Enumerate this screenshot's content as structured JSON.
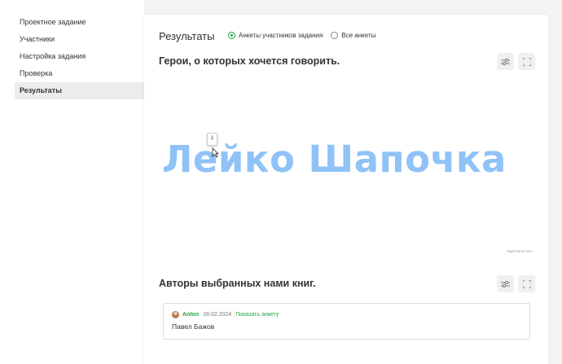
{
  "sidebar": {
    "items": [
      {
        "label": "Проектное задание"
      },
      {
        "label": "Участники"
      },
      {
        "label": "Настройка задания"
      },
      {
        "label": "Проверка"
      },
      {
        "label": "Результаты"
      }
    ]
  },
  "results": {
    "title": "Результаты",
    "filter_options": [
      {
        "label": "Анкеты участников задания",
        "checked": true
      },
      {
        "label": "Все анкеты",
        "checked": false
      }
    ]
  },
  "section1": {
    "title": "Герои, о которых хочется говорить.",
    "settings_icon": "sliders-icon",
    "fullscreen_icon": "fullscreen-icon"
  },
  "chart_data": {
    "type": "wordcloud",
    "words": [
      {
        "text": "Лейко Шапочка",
        "weight": 1
      }
    ],
    "tooltip_value": "1",
    "credits": "Highcharts.com",
    "color": "#8fc2f7"
  },
  "section2": {
    "title": "Авторы выбранных нами книг.",
    "answers": [
      {
        "author": "Anton",
        "date": "28.02.2024",
        "link_label": "Показать анкету",
        "text": "Павел Бажов"
      }
    ]
  },
  "colors": {
    "accent": "#25a244",
    "background": "#f3f3f4",
    "active_sidebar": "#ececec"
  }
}
